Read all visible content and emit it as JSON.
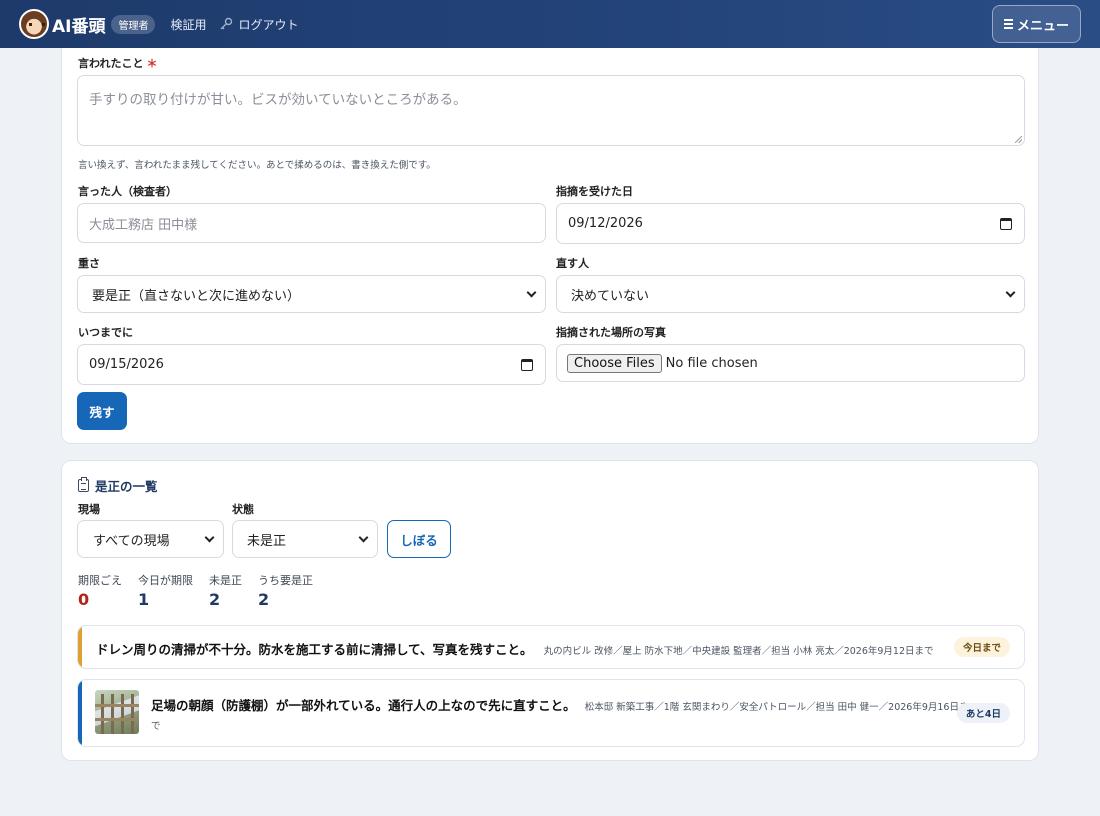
{
  "header": {
    "brand": "AI番頭",
    "role_badge": "管理者",
    "nav_verify": "検証用",
    "nav_logout": "ログアウト",
    "menu_label": "メニュー"
  },
  "form": {
    "said_label": "言われたこと",
    "said_required_mark": "＊",
    "said_placeholder": "手すりの取り付けが甘い。ビスが効いていないところがある。",
    "said_hint": "言い換えず、言われたまま残してください。あとで揉めるのは、書き換えた側です。",
    "speaker_label": "言った人（検査者）",
    "speaker_placeholder": "大成工務店 田中様",
    "date_label": "指摘を受けた日",
    "date_value": "09/12/2026",
    "severity_label": "重さ",
    "severity_value": "要是正（直さないと次に進めない）",
    "fixer_label": "直す人",
    "fixer_value": "決めていない",
    "due_label": "いつまでに",
    "due_value": "09/15/2026",
    "photo_label": "指摘された場所の写真",
    "photo_button": "Choose Files",
    "photo_status": "No file chosen",
    "submit_label": "残す"
  },
  "list": {
    "title": "是正の一覧",
    "filter_site_label": "現場",
    "filter_site_value": "すべての現場",
    "filter_state_label": "状態",
    "filter_state_value": "未是正",
    "filter_button": "しぼる",
    "stats": [
      {
        "label": "期限ごえ",
        "value": "0"
      },
      {
        "label": "今日が期限",
        "value": "1"
      },
      {
        "label": "未是正",
        "value": "2"
      },
      {
        "label": "うち要是正",
        "value": "2"
      }
    ],
    "items": [
      {
        "title": "ドレン周りの清掃が不十分。防水を施工する前に清掃して、写真を残すこと。",
        "meta": "丸の内ビル 改修／屋上 防水下地／中央建設 監理者／担当 小林 亮太／2026年9月12日まで",
        "badge": "今日まで",
        "accent": "#e0a030",
        "badge_bg": "#fdf3dc",
        "badge_color": "#6b4a0e"
      },
      {
        "title": "足場の朝顔（防護棚）が一部外れている。通行人の上なので先に直すこと。",
        "meta_line1": "松本邸 新築工事／1階 玄関まわり／安全パトロール／担当 田中 健一／2026年9月16日ま",
        "meta_line2": "で",
        "badge": "あと4日",
        "accent": "#1767b9",
        "badge_bg": "#eef2f8",
        "badge_color": "#1f3a64"
      }
    ]
  }
}
